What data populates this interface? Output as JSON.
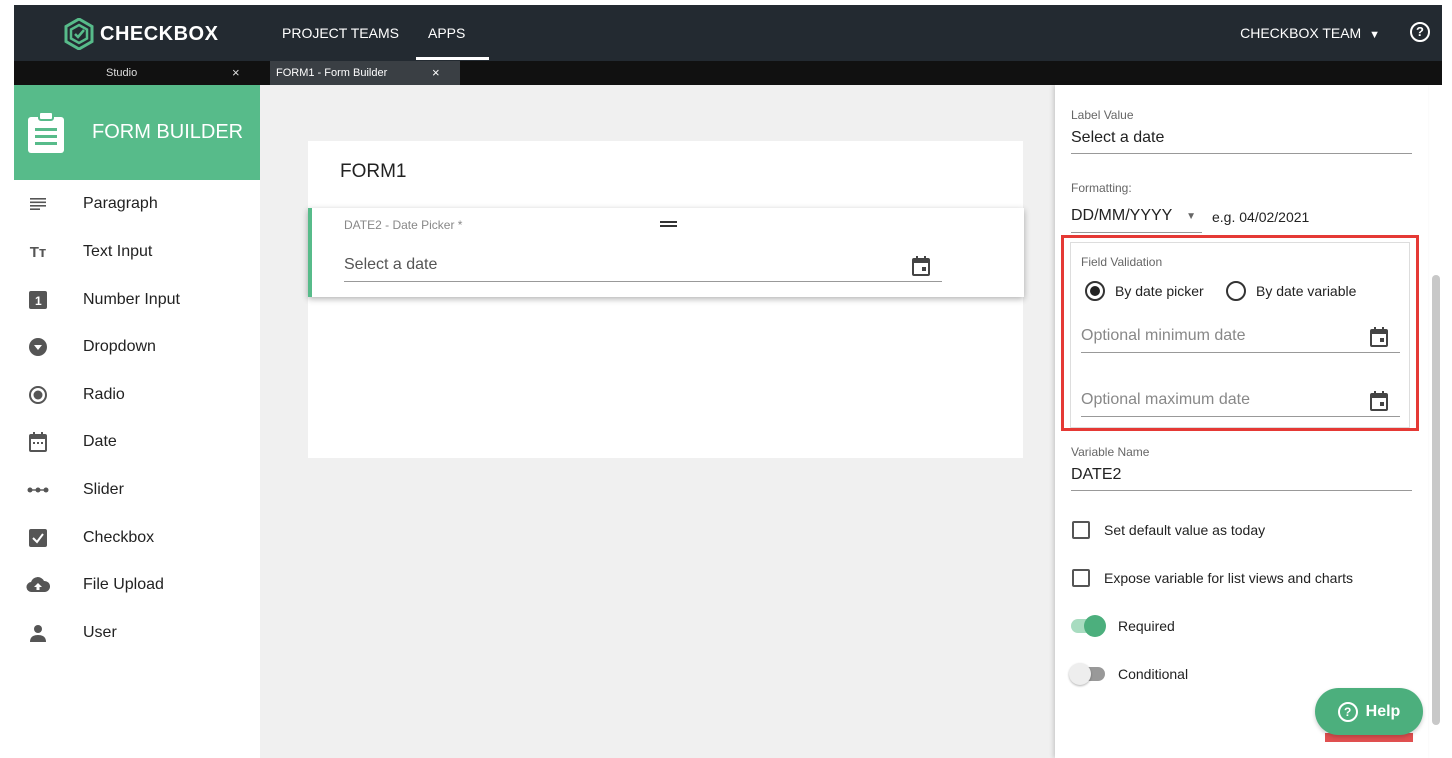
{
  "brand": {
    "name": "CHECKBOX",
    "accent": "#57bb8a"
  },
  "nav": {
    "items": [
      "PROJECT TEAMS",
      "APPS"
    ],
    "active": "APPS",
    "team": "CHECKBOX TEAM",
    "help_icon": "question-circle-icon"
  },
  "tabs": [
    {
      "label": "Studio",
      "close": "×"
    },
    {
      "label": "FORM1 - Form Builder",
      "close": "×"
    }
  ],
  "sidebar": {
    "title": "FORM BUILDER",
    "items": [
      {
        "label": "Paragraph",
        "icon": "paragraph-icon"
      },
      {
        "label": "Text Input",
        "icon": "text-input-icon"
      },
      {
        "label": "Number Input",
        "icon": "number-input-icon"
      },
      {
        "label": "Dropdown",
        "icon": "dropdown-icon"
      },
      {
        "label": "Radio",
        "icon": "radio-icon"
      },
      {
        "label": "Date",
        "icon": "date-icon"
      },
      {
        "label": "Slider",
        "icon": "slider-icon"
      },
      {
        "label": "Checkbox",
        "icon": "checkbox-icon"
      },
      {
        "label": "File Upload",
        "icon": "upload-icon"
      },
      {
        "label": "User",
        "icon": "user-icon"
      }
    ]
  },
  "form": {
    "title": "FORM1",
    "field": {
      "label": "DATE2 - Date Picker *",
      "placeholder": "Select a date"
    }
  },
  "panel": {
    "label_value_caption": "Label Value",
    "label_value": "Select a date",
    "formatting_caption": "Formatting:",
    "format": "DD/MM/YYYY",
    "format_example": "e.g. 04/02/2021",
    "validation": {
      "caption": "Field Validation",
      "option1": "By date picker",
      "option2": "By date variable",
      "selected": "By date picker",
      "min_placeholder": "Optional minimum date",
      "max_placeholder": "Optional maximum date"
    },
    "variable_caption": "Variable Name",
    "variable_name": "DATE2",
    "check_default": "Set default value as today",
    "check_expose": "Expose variable for list views and charts",
    "toggle_required": "Required",
    "toggle_required_on": true,
    "toggle_conditional": "Conditional",
    "toggle_conditional_on": false
  },
  "help_button": "Help"
}
